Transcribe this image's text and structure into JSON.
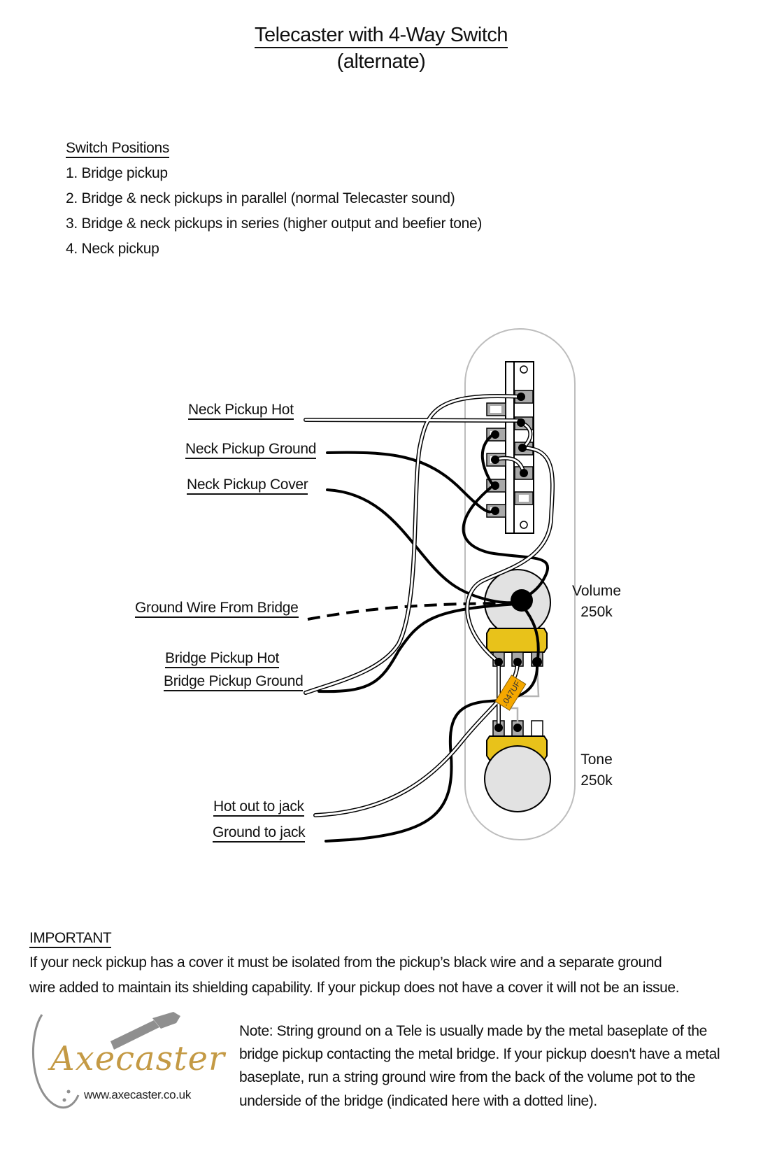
{
  "header": {
    "title": "Telecaster with 4-Way Switch",
    "subtitle": "(alternate)"
  },
  "switch_positions": {
    "heading": "Switch Positions",
    "items": [
      "1. Bridge pickup",
      "2. Bridge & neck pickups in parallel (normal Telecaster sound)",
      "3. Bridge & neck pickups in series (higher output and beefier tone)",
      "4. Neck pickup"
    ]
  },
  "wire_labels": {
    "neck_hot": "Neck Pickup Hot",
    "neck_ground": "Neck Pickup Ground",
    "neck_cover": "Neck Pickup Cover",
    "bridge_ground_wire": "Ground Wire From Bridge",
    "bridge_hot": "Bridge Pickup Hot",
    "bridge_ground": "Bridge Pickup Ground",
    "hot_out": "Hot out to jack",
    "ground_out": "Ground to jack"
  },
  "components": {
    "volume": {
      "name": "Volume",
      "value": "250k"
    },
    "tone": {
      "name": "Tone",
      "value": "250k"
    },
    "capacitor": {
      "label": ".047UF"
    }
  },
  "important": {
    "heading": "IMPORTANT",
    "lines": [
      "If your neck pickup has a cover it must be isolated from the pickup’s black wire and a separate ground",
      " wire added to maintain its shielding capability. If your pickup does not have a cover it will not be an issue."
    ]
  },
  "note": {
    "lines": [
      "Note: String ground on a Tele is usually made by the metal baseplate of the",
      "bridge pickup contacting the metal bridge. If your pickup doesn't have a metal",
      "baseplate, run a string ground wire from the back of the volume pot to the",
      "underside of the bridge (indicated here with a dotted line)."
    ]
  },
  "logo": {
    "brand": "Axecaster",
    "url": "www.axecaster.co.uk"
  },
  "colors": {
    "pot_body": "#e8c21a",
    "pot_knob": "#e2e2e2",
    "lug_gray": "#a9a9a9",
    "capacitor": "#f5a800",
    "plate_outline": "#bdbdbd",
    "logo_gold": "#c49a45",
    "logo_gray": "#8f8f8f"
  }
}
